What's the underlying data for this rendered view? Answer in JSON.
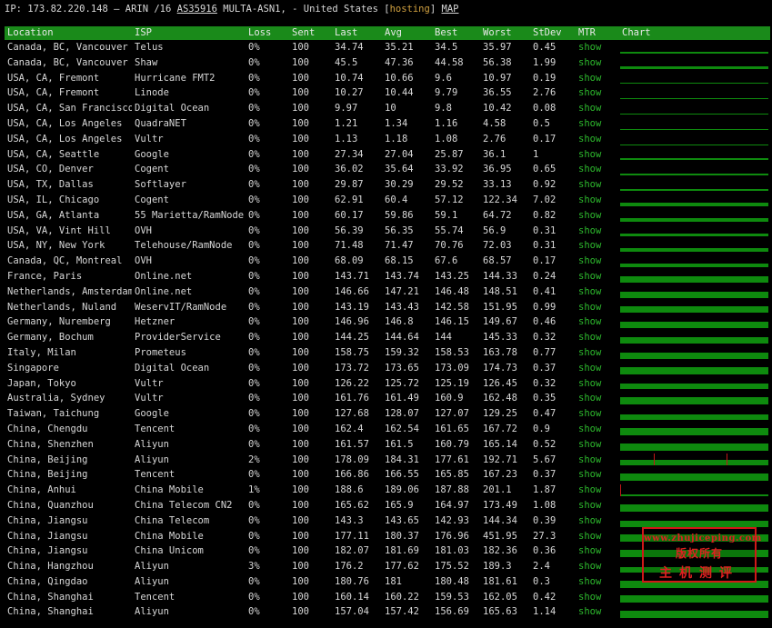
{
  "header": {
    "prefix": "IP: 173.82.220.148 – ARIN /16 ",
    "asn": "AS35916",
    "middle": " MULTA-ASN1, - United States [",
    "tag": "hosting",
    "close": "] ",
    "map": "MAP"
  },
  "columns": [
    "Location",
    "ISP",
    "Loss",
    "Sent",
    "Last",
    "Avg",
    "Best",
    "Worst",
    "StDev",
    "MTR",
    "Chart"
  ],
  "colors": {
    "header_bg": "#1a8a1a",
    "chart_bar": "#0e8a0e",
    "mtr_link": "#2db82d",
    "spike": "#c01818",
    "stamp": "#d01818"
  },
  "rows": [
    {
      "location": "Canada, BC, Vancouver",
      "isp": "Telus",
      "loss": "0%",
      "sent": "100",
      "last": "34.74",
      "avg": "35.21",
      "best": "34.5",
      "worst": "35.97",
      "stdev": "0.45",
      "mtr": "show",
      "chart_level": 0.22,
      "spikes": []
    },
    {
      "location": "Canada, BC, Vancouver",
      "isp": "Shaw",
      "loss": "0%",
      "sent": "100",
      "last": "45.5",
      "avg": "47.36",
      "best": "44.58",
      "worst": "56.38",
      "stdev": "1.99",
      "mtr": "show",
      "chart_level": 0.3,
      "spikes": []
    },
    {
      "location": "USA, CA, Fremont",
      "isp": "Hurricane FMT2",
      "loss": "0%",
      "sent": "100",
      "last": "10.74",
      "avg": "10.66",
      "best": "9.6",
      "worst": "10.97",
      "stdev": "0.19",
      "mtr": "show",
      "chart_level": 0.08,
      "spikes": []
    },
    {
      "location": "USA, CA, Fremont",
      "isp": "Linode",
      "loss": "0%",
      "sent": "100",
      "last": "10.27",
      "avg": "10.44",
      "best": "9.79",
      "worst": "36.55",
      "stdev": "2.76",
      "mtr": "show",
      "chart_level": 0.08,
      "spikes": []
    },
    {
      "location": "USA, CA, San Francisco",
      "isp": "Digital Ocean",
      "loss": "0%",
      "sent": "100",
      "last": "9.97",
      "avg": "10",
      "best": "9.8",
      "worst": "10.42",
      "stdev": "0.08",
      "mtr": "show",
      "chart_level": 0.08,
      "spikes": []
    },
    {
      "location": "USA, CA, Los Angeles",
      "isp": "QuadraNET",
      "loss": "0%",
      "sent": "100",
      "last": "1.21",
      "avg": "1.34",
      "best": "1.16",
      "worst": "4.58",
      "stdev": "0.5",
      "mtr": "show",
      "chart_level": 0.06,
      "spikes": []
    },
    {
      "location": "USA, CA, Los Angeles",
      "isp": "Vultr",
      "loss": "0%",
      "sent": "100",
      "last": "1.13",
      "avg": "1.18",
      "best": "1.08",
      "worst": "2.76",
      "stdev": "0.17",
      "mtr": "show",
      "chart_level": 0.06,
      "spikes": []
    },
    {
      "location": "USA, CA, Seattle",
      "isp": "Google",
      "loss": "0%",
      "sent": "100",
      "last": "27.34",
      "avg": "27.04",
      "best": "25.87",
      "worst": "36.1",
      "stdev": "1",
      "mtr": "show",
      "chart_level": 0.18,
      "spikes": []
    },
    {
      "location": "USA, CO, Denver",
      "isp": "Cogent",
      "loss": "0%",
      "sent": "100",
      "last": "36.02",
      "avg": "35.64",
      "best": "33.92",
      "worst": "36.95",
      "stdev": "0.65",
      "mtr": "show",
      "chart_level": 0.22,
      "spikes": []
    },
    {
      "location": "USA, TX, Dallas",
      "isp": "Softlayer",
      "loss": "0%",
      "sent": "100",
      "last": "29.87",
      "avg": "30.29",
      "best": "29.52",
      "worst": "33.13",
      "stdev": "0.92",
      "mtr": "show",
      "chart_level": 0.2,
      "spikes": []
    },
    {
      "location": "USA, IL, Chicago",
      "isp": "Cogent",
      "loss": "0%",
      "sent": "100",
      "last": "62.91",
      "avg": "60.4",
      "best": "57.12",
      "worst": "122.34",
      "stdev": "7.02",
      "mtr": "show",
      "chart_level": 0.35,
      "spikes": []
    },
    {
      "location": "USA, GA, Atlanta",
      "isp": "55 Marietta/RamNode",
      "loss": "0%",
      "sent": "100",
      "last": "60.17",
      "avg": "59.86",
      "best": "59.1",
      "worst": "64.72",
      "stdev": "0.82",
      "mtr": "show",
      "chart_level": 0.35,
      "spikes": []
    },
    {
      "location": "USA, VA, Vint Hill",
      "isp": "OVH",
      "loss": "0%",
      "sent": "100",
      "last": "56.39",
      "avg": "56.35",
      "best": "55.74",
      "worst": "56.9",
      "stdev": "0.31",
      "mtr": "show",
      "chart_level": 0.34,
      "spikes": []
    },
    {
      "location": "USA, NY, New York",
      "isp": "Telehouse/RamNode",
      "loss": "0%",
      "sent": "100",
      "last": "71.48",
      "avg": "71.47",
      "best": "70.76",
      "worst": "72.03",
      "stdev": "0.31",
      "mtr": "show",
      "chart_level": 0.4,
      "spikes": []
    },
    {
      "location": "Canada, QC, Montreal",
      "isp": "OVH",
      "loss": "0%",
      "sent": "100",
      "last": "68.09",
      "avg": "68.15",
      "best": "67.6",
      "worst": "68.57",
      "stdev": "0.17",
      "mtr": "show",
      "chart_level": 0.4,
      "spikes": []
    },
    {
      "location": "France, Paris",
      "isp": "Online.net",
      "loss": "0%",
      "sent": "100",
      "last": "143.71",
      "avg": "143.74",
      "best": "143.25",
      "worst": "144.33",
      "stdev": "0.24",
      "mtr": "show",
      "chart_level": 0.7,
      "spikes": []
    },
    {
      "location": "Netherlands, Amsterdam",
      "isp": "Online.net",
      "loss": "0%",
      "sent": "100",
      "last": "146.66",
      "avg": "147.21",
      "best": "146.48",
      "worst": "148.51",
      "stdev": "0.41",
      "mtr": "show",
      "chart_level": 0.7,
      "spikes": []
    },
    {
      "location": "Netherlands, Nuland",
      "isp": "WeservIT/RamNode",
      "loss": "0%",
      "sent": "100",
      "last": "143.19",
      "avg": "143.43",
      "best": "142.58",
      "worst": "151.95",
      "stdev": "0.99",
      "mtr": "show",
      "chart_level": 0.7,
      "spikes": []
    },
    {
      "location": "Germany, Nuremberg",
      "isp": "Hetzner",
      "loss": "0%",
      "sent": "100",
      "last": "146.96",
      "avg": "146.8",
      "best": "146.15",
      "worst": "149.67",
      "stdev": "0.46",
      "mtr": "show",
      "chart_level": 0.7,
      "spikes": []
    },
    {
      "location": "Germany, Bochum",
      "isp": "ProviderService",
      "loss": "0%",
      "sent": "100",
      "last": "144.25",
      "avg": "144.64",
      "best": "144",
      "worst": "145.33",
      "stdev": "0.32",
      "mtr": "show",
      "chart_level": 0.7,
      "spikes": []
    },
    {
      "location": "Italy, Milan",
      "isp": "Prometeus",
      "loss": "0%",
      "sent": "100",
      "last": "158.75",
      "avg": "159.32",
      "best": "158.53",
      "worst": "163.78",
      "stdev": "0.77",
      "mtr": "show",
      "chart_level": 0.74,
      "spikes": []
    },
    {
      "location": "Singapore",
      "isp": "Digital Ocean",
      "loss": "0%",
      "sent": "100",
      "last": "173.72",
      "avg": "173.65",
      "best": "173.09",
      "worst": "174.73",
      "stdev": "0.37",
      "mtr": "show",
      "chart_level": 0.8,
      "spikes": []
    },
    {
      "location": "Japan, Tokyo",
      "isp": "Vultr",
      "loss": "0%",
      "sent": "100",
      "last": "126.22",
      "avg": "125.72",
      "best": "125.19",
      "worst": "126.45",
      "stdev": "0.32",
      "mtr": "show",
      "chart_level": 0.62,
      "spikes": []
    },
    {
      "location": "Australia, Sydney",
      "isp": "Vultr",
      "loss": "0%",
      "sent": "100",
      "last": "161.76",
      "avg": "161.49",
      "best": "160.9",
      "worst": "162.48",
      "stdev": "0.35",
      "mtr": "show",
      "chart_level": 0.76,
      "spikes": []
    },
    {
      "location": "Taiwan, Taichung",
      "isp": "Google",
      "loss": "0%",
      "sent": "100",
      "last": "127.68",
      "avg": "128.07",
      "best": "127.07",
      "worst": "129.25",
      "stdev": "0.47",
      "mtr": "show",
      "chart_level": 0.62,
      "spikes": []
    },
    {
      "location": "China, Chengdu",
      "isp": "Tencent",
      "loss": "0%",
      "sent": "100",
      "last": "162.4",
      "avg": "162.54",
      "best": "161.65",
      "worst": "167.72",
      "stdev": "0.9",
      "mtr": "show",
      "chart_level": 0.76,
      "spikes": []
    },
    {
      "location": "China, Shenzhen",
      "isp": "Aliyun",
      "loss": "0%",
      "sent": "100",
      "last": "161.57",
      "avg": "161.5",
      "best": "160.79",
      "worst": "165.14",
      "stdev": "0.52",
      "mtr": "show",
      "chart_level": 0.76,
      "spikes": []
    },
    {
      "location": "China, Beijing",
      "isp": "Aliyun",
      "loss": "2%",
      "sent": "100",
      "last": "178.09",
      "avg": "184.31",
      "best": "177.61",
      "worst": "192.71",
      "stdev": "5.67",
      "mtr": "show",
      "chart_level": 0.55,
      "spikes": [
        0.23,
        0.73
      ]
    },
    {
      "location": "China, Beijing",
      "isp": "Tencent",
      "loss": "0%",
      "sent": "100",
      "last": "166.86",
      "avg": "166.55",
      "best": "165.85",
      "worst": "167.23",
      "stdev": "0.37",
      "mtr": "show",
      "chart_level": 0.78,
      "spikes": []
    },
    {
      "location": "China, Anhui",
      "isp": "China Mobile",
      "loss": "1%",
      "sent": "100",
      "last": "188.6",
      "avg": "189.06",
      "best": "187.88",
      "worst": "201.1",
      "stdev": "1.87",
      "mtr": "show",
      "chart_level": 0.15,
      "spikes": [
        0.0
      ]
    },
    {
      "location": "China, Quanzhou",
      "isp": "China Telecom CN2",
      "loss": "0%",
      "sent": "100",
      "last": "165.62",
      "avg": "165.9",
      "best": "164.97",
      "worst": "173.49",
      "stdev": "1.08",
      "mtr": "show",
      "chart_level": 0.78,
      "spikes": []
    },
    {
      "location": "China, Jiangsu",
      "isp": "China Telecom",
      "loss": "0%",
      "sent": "100",
      "last": "143.3",
      "avg": "143.65",
      "best": "142.93",
      "worst": "144.34",
      "stdev": "0.39",
      "mtr": "show",
      "chart_level": 0.7,
      "spikes": []
    },
    {
      "location": "China, Jiangsu",
      "isp": "China Mobile",
      "loss": "0%",
      "sent": "100",
      "last": "177.11",
      "avg": "180.37",
      "best": "176.96",
      "worst": "451.95",
      "stdev": "27.3",
      "mtr": "show",
      "chart_level": 0.8,
      "spikes": []
    },
    {
      "location": "China, Jiangsu",
      "isp": "China Unicom",
      "loss": "0%",
      "sent": "100",
      "last": "182.07",
      "avg": "181.69",
      "best": "181.03",
      "worst": "182.36",
      "stdev": "0.36",
      "mtr": "show",
      "chart_level": 0.82,
      "spikes": []
    },
    {
      "location": "China, Hangzhou",
      "isp": "Aliyun",
      "loss": "3%",
      "sent": "100",
      "last": "176.2",
      "avg": "177.62",
      "best": "175.52",
      "worst": "189.3",
      "stdev": "2.4",
      "mtr": "show",
      "chart_level": 0.6,
      "spikes": []
    },
    {
      "location": "China, Qingdao",
      "isp": "Aliyun",
      "loss": "0%",
      "sent": "100",
      "last": "180.76",
      "avg": "181",
      "best": "180.48",
      "worst": "181.61",
      "stdev": "0.3",
      "mtr": "show",
      "chart_level": 0.82,
      "spikes": []
    },
    {
      "location": "China, Shanghai",
      "isp": "Tencent",
      "loss": "0%",
      "sent": "100",
      "last": "160.14",
      "avg": "160.22",
      "best": "159.53",
      "worst": "162.05",
      "stdev": "0.42",
      "mtr": "show",
      "chart_level": 0.76,
      "spikes": []
    },
    {
      "location": "China, Shanghai",
      "isp": "Aliyun",
      "loss": "0%",
      "sent": "100",
      "last": "157.04",
      "avg": "157.42",
      "best": "156.69",
      "worst": "165.63",
      "stdev": "1.14",
      "mtr": "show",
      "chart_level": 0.75,
      "spikes": []
    }
  ],
  "watermark": {
    "url": "www.zhujiceping.com",
    "line2": "版权所有",
    "line3": "主机测评"
  }
}
